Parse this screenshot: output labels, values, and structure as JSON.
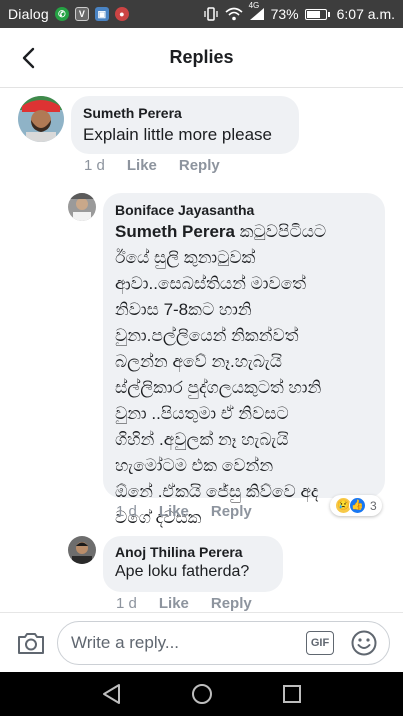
{
  "status_bar": {
    "carrier": "Dialog",
    "network": "4G",
    "battery": "73%",
    "battery_level": 0.73,
    "time": "6:07 a.m."
  },
  "header": {
    "title": "Replies"
  },
  "comments": [
    {
      "author": "Sumeth Perera",
      "text": "Explain little more please",
      "time": "1 d",
      "like_label": "Like",
      "reply_label": "Reply"
    },
    {
      "author": "Boniface Jayasantha",
      "mention": "Sumeth Perera",
      "text_lines": [
        " කටුවපිටියට",
        "ඊයේ සුලි කුනාටුවක්",
        "ආවා..සෙබස්තියන් මාවතේ",
        "නිවාස 7-8කට හානි",
        "වුනා.පල්ලියෙන් නිකන්වත්",
        "බලන්න අවේ නෑ.හැබැයි",
        "ස්ල්ලිකාර පුද්ගලයකුටත් හානි",
        "වුනා ..පියතුමා ඒ නිවසට",
        "ගිහින් .අවුලක් නෑ හැබැයි",
        "හැමෝටම එක වෙන්න",
        "ඕනේ .ඒකයි ජේසු කිව්වෙ අද",
        "වගේ දවසක"
      ],
      "time": "1 d",
      "like_label": "Like",
      "reply_label": "Reply",
      "reaction_count": "3",
      "reaction_icons": [
        "sad-reaction",
        "like-reaction"
      ]
    },
    {
      "author": "Anoj Thilina Perera",
      "text": "Ape loku fatherda?",
      "time": "1 d",
      "like_label": "Like",
      "reply_label": "Reply"
    }
  ],
  "composer": {
    "placeholder": "Write a reply...",
    "gif_label": "GIF"
  },
  "colors": {
    "bubble": "#eff1f4",
    "meta_text": "#8d949e",
    "like_blue": "#1877f2",
    "status_bar": "#3d3d3d"
  }
}
